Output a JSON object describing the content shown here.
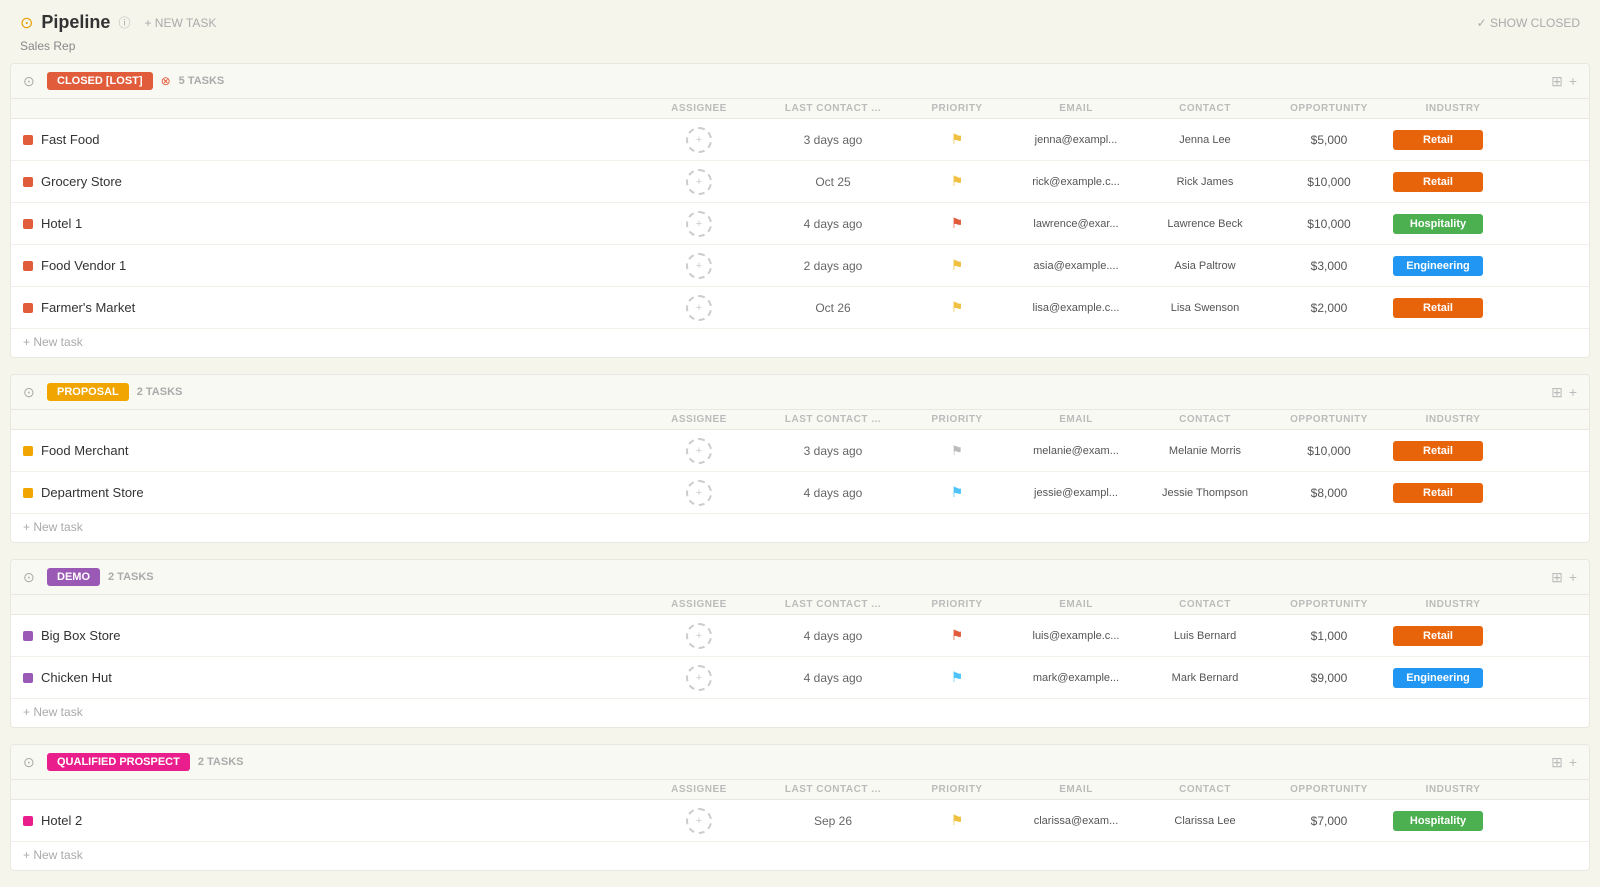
{
  "header": {
    "title": "Pipeline",
    "new_task_label": "+ NEW TASK",
    "show_closed_label": "✓ SHOW CLOSED",
    "sub_label": "Sales Rep"
  },
  "columns": {
    "task": "",
    "assignee": "ASSIGNEE",
    "last_contact": "LAST CONTACT ...",
    "priority": "PRIORITY",
    "email": "EMAIL",
    "contact": "CONTACT",
    "opportunity": "OPPORTUNITY",
    "industry": "INDUSTRY"
  },
  "groups": [
    {
      "id": "closed-lost",
      "label": "CLOSED [LOST]",
      "label_class": "closed-lost",
      "task_count": "5 TASKS",
      "dot_color": "#e05c3a",
      "tasks": [
        {
          "name": "Fast Food",
          "last_contact": "3 days ago",
          "priority_flag": "🏳️",
          "flag_color": "#f0c040",
          "email": "jenna@exampl...",
          "contact": "Jenna Lee",
          "opportunity": "$5,000",
          "industry": "Retail",
          "industry_class": "retail"
        },
        {
          "name": "Grocery Store",
          "last_contact": "Oct 25",
          "priority_flag": "🏳️",
          "flag_color": "#f0c040",
          "email": "rick@example.c...",
          "contact": "Rick James",
          "opportunity": "$10,000",
          "industry": "Retail",
          "industry_class": "retail"
        },
        {
          "name": "Hotel 1",
          "last_contact": "4 days ago",
          "priority_flag": "🚩",
          "flag_color": "#e05c3a",
          "email": "lawrence@exar...",
          "contact": "Lawrence Beck",
          "opportunity": "$10,000",
          "industry": "Hospitality",
          "industry_class": "hospitality"
        },
        {
          "name": "Food Vendor 1",
          "last_contact": "2 days ago",
          "priority_flag": "🏳️",
          "flag_color": "#f0c040",
          "email": "asia@example....",
          "contact": "Asia Paltrow",
          "opportunity": "$3,000",
          "industry": "Engineering",
          "industry_class": "engineering"
        },
        {
          "name": "Farmer's Market",
          "last_contact": "Oct 26",
          "priority_flag": "🏳️",
          "flag_color": "#f0c040",
          "email": "lisa@example.c...",
          "contact": "Lisa Swenson",
          "opportunity": "$2,000",
          "industry": "Retail",
          "industry_class": "retail"
        }
      ]
    },
    {
      "id": "proposal",
      "label": "PROPOSAL",
      "label_class": "proposal",
      "task_count": "2 TASKS",
      "dot_color": "#f0a500",
      "tasks": [
        {
          "name": "Food Merchant",
          "last_contact": "3 days ago",
          "priority_flag": "⬜",
          "flag_color": "#ccc",
          "email": "melanie@exam...",
          "contact": "Melanie Morris",
          "opportunity": "$10,000",
          "industry": "Retail",
          "industry_class": "retail"
        },
        {
          "name": "Department Store",
          "last_contact": "4 days ago",
          "priority_flag": "🏳️",
          "flag_color": "#4fc3f7",
          "email": "jessie@exampl...",
          "contact": "Jessie Thompson",
          "opportunity": "$8,000",
          "industry": "Retail",
          "industry_class": "retail"
        }
      ]
    },
    {
      "id": "demo",
      "label": "DEMO",
      "label_class": "demo",
      "task_count": "2 TASKS",
      "dot_color": "#9b59b6",
      "tasks": [
        {
          "name": "Big Box Store",
          "last_contact": "4 days ago",
          "priority_flag": "🚩",
          "flag_color": "#e05c3a",
          "email": "luis@example.c...",
          "contact": "Luis Bernard",
          "opportunity": "$1,000",
          "industry": "Retail",
          "industry_class": "retail"
        },
        {
          "name": "Chicken Hut",
          "last_contact": "4 days ago",
          "priority_flag": "🏳️",
          "flag_color": "#4fc3f7",
          "email": "mark@example...",
          "contact": "Mark Bernard",
          "opportunity": "$9,000",
          "industry": "Engineering",
          "industry_class": "engineering"
        }
      ]
    },
    {
      "id": "qualified-prospect",
      "label": "QUALIFIED PROSPECT",
      "label_class": "qualified-prospect",
      "task_count": "2 TASKS",
      "dot_color": "#e91e8c",
      "tasks": [
        {
          "name": "Hotel 2",
          "last_contact": "Sep 26",
          "priority_flag": "🏳️",
          "flag_color": "#f0c040",
          "email": "clarissa@exam...",
          "contact": "Clarissa Lee",
          "opportunity": "$7,000",
          "industry": "Hospitality",
          "industry_class": "hospitality"
        }
      ]
    }
  ],
  "new_task_label": "+ New task"
}
